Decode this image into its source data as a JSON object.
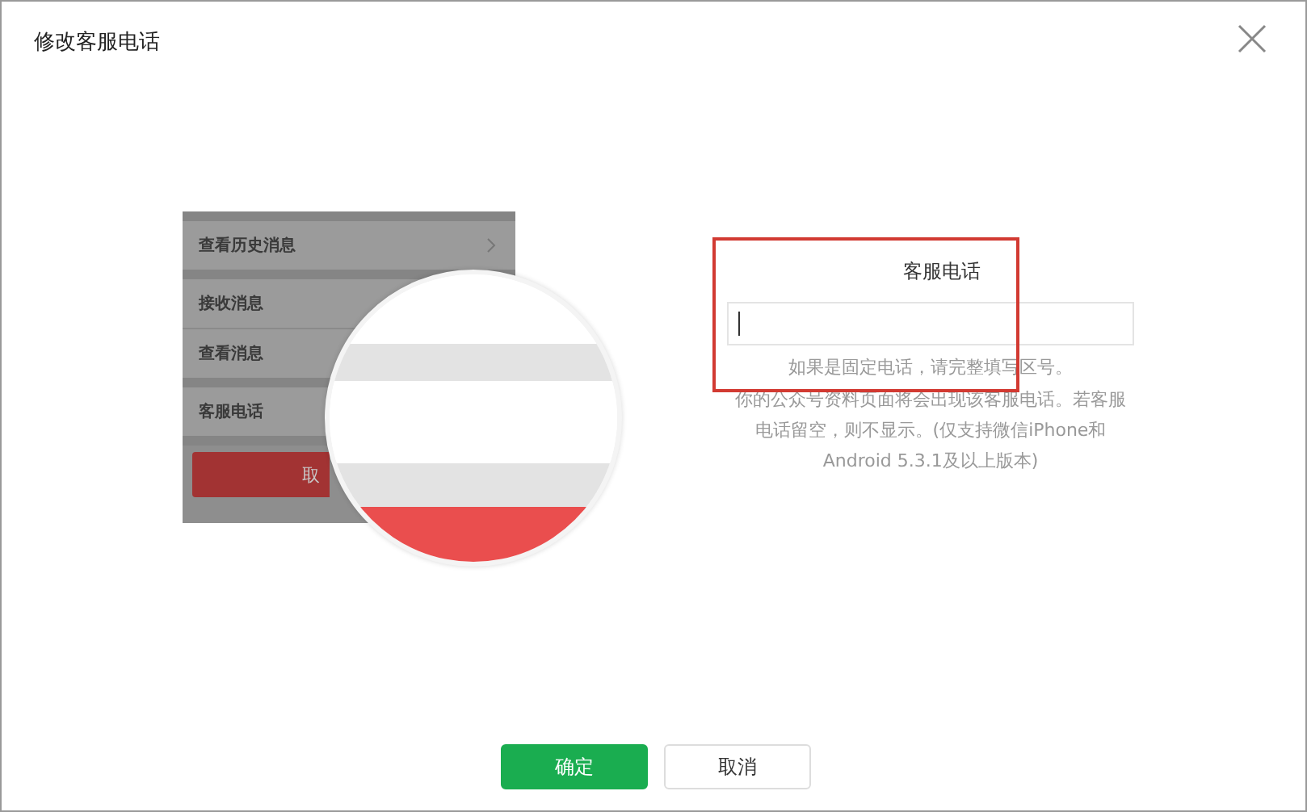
{
  "dialog": {
    "title": "修改客服电话"
  },
  "preview": {
    "groups": [
      {
        "items": [
          {
            "label": "查看历史消息",
            "kind": "link"
          }
        ]
      },
      {
        "items": [
          {
            "label": "接收消息",
            "kind": "plain"
          },
          {
            "label": "查看消息",
            "kind": "plain"
          }
        ]
      },
      {
        "items": [
          {
            "label": "客服电话",
            "kind": "plain"
          }
        ]
      }
    ],
    "cancel_button": "取"
  },
  "form": {
    "label": "客服电话",
    "highlighted": true,
    "hint": "如果是固定电话，请完整填写区号。",
    "description": "你的公众号资料页面将会出现该客服电话。若客服电话留空，则不显示。(仅支持微信iPhone和Android 5.3.1及以上版本)"
  },
  "buttons": [
    {
      "label": "确定",
      "kind": "primary"
    },
    {
      "label": "取消",
      "kind": "default"
    }
  ]
}
